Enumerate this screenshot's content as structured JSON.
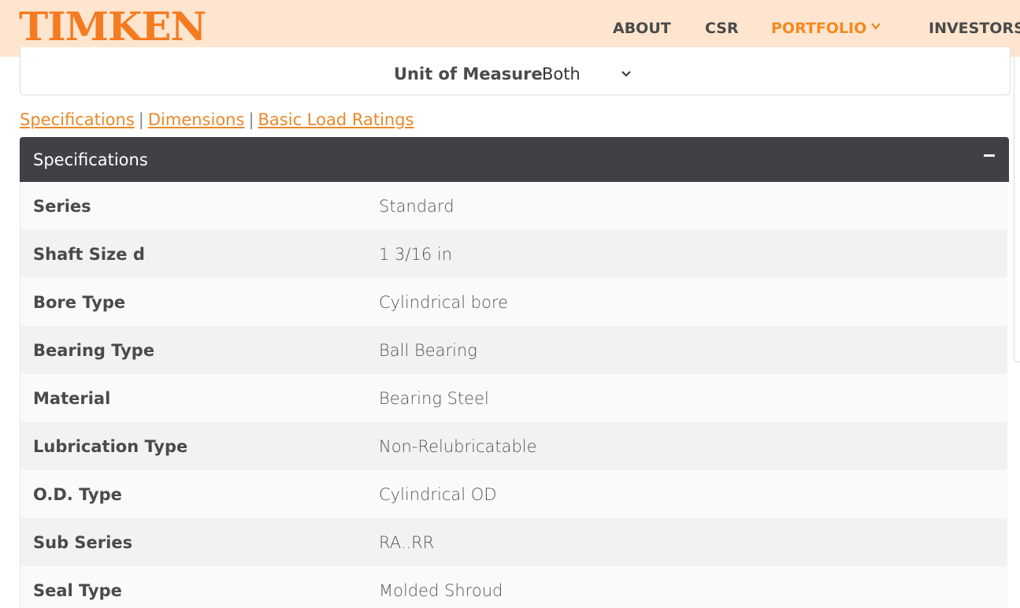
{
  "header": {
    "logo": "TIMKEN",
    "nav": [
      {
        "label": "ABOUT",
        "active": false
      },
      {
        "label": "CSR",
        "active": false
      },
      {
        "label": "PORTFOLIO",
        "active": true,
        "icon": "chevron-down-icon"
      },
      {
        "label": "INVESTORS",
        "active": false
      }
    ]
  },
  "unit_of_measure": {
    "label": "Unit of Measure",
    "selected": "Both",
    "icon": "chevron-down-icon"
  },
  "anchors": {
    "items": [
      "Specifications",
      "Dimensions",
      "Basic Load Ratings"
    ],
    "separator": "|"
  },
  "panel": {
    "title": "Specifications",
    "collapse_icon": "minus-icon",
    "rows": [
      {
        "label": "Series",
        "value": "Standard"
      },
      {
        "label": "Shaft Size d",
        "value": "1 3/16 in"
      },
      {
        "label": "Bore Type",
        "value": "Cylindrical bore"
      },
      {
        "label": "Bearing Type",
        "value": "Ball Bearing"
      },
      {
        "label": "Material",
        "value": "Bearing Steel"
      },
      {
        "label": "Lubrication Type",
        "value": "Non-Relubricatable"
      },
      {
        "label": "O.D. Type",
        "value": "Cylindrical OD"
      },
      {
        "label": "Sub Series",
        "value": "RA..RR"
      },
      {
        "label": "Seal Type",
        "value": "Molded Shroud"
      }
    ]
  },
  "colors": {
    "brand_orange": "#f47b20",
    "header_bg": "#fde5cf",
    "link_orange": "#e8892a",
    "panel_header_bg": "#404045"
  }
}
